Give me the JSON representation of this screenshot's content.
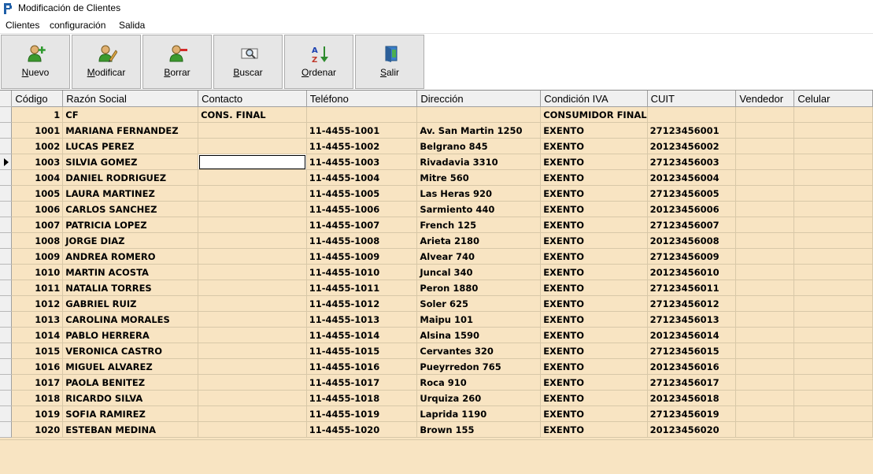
{
  "window": {
    "title": "Modificación de Clientes"
  },
  "menu": [
    "Clientes",
    "configuración",
    "Salida"
  ],
  "toolbar": {
    "nuevo": "Nuevo",
    "modificar": "Modificar",
    "borrar": "Borrar",
    "buscar": "Buscar",
    "ordenar": "Ordenar",
    "salir": "Salir"
  },
  "grid": {
    "columns": [
      "Código",
      "Razón Social",
      "Contacto",
      "Teléfono",
      "Dirección",
      "Condición IVA",
      "CUIT",
      "Vendedor",
      "Celular"
    ],
    "rows": [
      [
        "1",
        "CF",
        "CONS. FINAL",
        "",
        "",
        "CONSUMIDOR FINAL",
        "",
        "",
        ""
      ],
      [
        "1001",
        "MARIANA FERNANDEZ",
        "",
        "11-4455-1001",
        "Av. San Martin 1250",
        "EXENTO",
        "27123456001",
        "",
        ""
      ],
      [
        "1002",
        "LUCAS PEREZ",
        "",
        "11-4455-1002",
        "Belgrano 845",
        "EXENTO",
        "20123456002",
        "",
        ""
      ],
      [
        "1003",
        "SILVIA GOMEZ",
        "",
        "11-4455-1003",
        "Rivadavia 3310",
        "EXENTO",
        "27123456003",
        "",
        ""
      ],
      [
        "1004",
        "DANIEL RODRIGUEZ",
        "",
        "11-4455-1004",
        "Mitre 560",
        "EXENTO",
        "20123456004",
        "",
        ""
      ],
      [
        "1005",
        "LAURA MARTINEZ",
        "",
        "11-4455-1005",
        "Las Heras 920",
        "EXENTO",
        "27123456005",
        "",
        ""
      ],
      [
        "1006",
        "CARLOS SANCHEZ",
        "",
        "11-4455-1006",
        "Sarmiento 440",
        "EXENTO",
        "20123456006",
        "",
        ""
      ],
      [
        "1007",
        "PATRICIA LOPEZ",
        "",
        "11-4455-1007",
        "French 125",
        "EXENTO",
        "27123456007",
        "",
        ""
      ],
      [
        "1008",
        "JORGE DIAZ",
        "",
        "11-4455-1008",
        "Arieta 2180",
        "EXENTO",
        "20123456008",
        "",
        ""
      ],
      [
        "1009",
        "ANDREA ROMERO",
        "",
        "11-4455-1009",
        "Alvear 740",
        "EXENTO",
        "27123456009",
        "",
        ""
      ],
      [
        "1010",
        "MARTIN ACOSTA",
        "",
        "11-4455-1010",
        "Juncal 340",
        "EXENTO",
        "20123456010",
        "",
        ""
      ],
      [
        "1011",
        "NATALIA TORRES",
        "",
        "11-4455-1011",
        "Peron 1880",
        "EXENTO",
        "27123456011",
        "",
        ""
      ],
      [
        "1012",
        "GABRIEL RUIZ",
        "",
        "11-4455-1012",
        "Soler 625",
        "EXENTO",
        "27123456012",
        "",
        ""
      ],
      [
        "1013",
        "CAROLINA MORALES",
        "",
        "11-4455-1013",
        "Maipu 101",
        "EXENTO",
        "27123456013",
        "",
        ""
      ],
      [
        "1014",
        "PABLO HERRERA",
        "",
        "11-4455-1014",
        "Alsina 1590",
        "EXENTO",
        "20123456014",
        "",
        ""
      ],
      [
        "1015",
        "VERONICA CASTRO",
        "",
        "11-4455-1015",
        "Cervantes 320",
        "EXENTO",
        "27123456015",
        "",
        ""
      ],
      [
        "1016",
        "MIGUEL ALVAREZ",
        "",
        "11-4455-1016",
        "Pueyrredon 765",
        "EXENTO",
        "20123456016",
        "",
        ""
      ],
      [
        "1017",
        "PAOLA BENITEZ",
        "",
        "11-4455-1017",
        "Roca 910",
        "EXENTO",
        "27123456017",
        "",
        ""
      ],
      [
        "1018",
        "RICARDO SILVA",
        "",
        "11-4455-1018",
        "Urquiza 260",
        "EXENTO",
        "20123456018",
        "",
        ""
      ],
      [
        "1019",
        "SOFIA RAMIREZ",
        "",
        "11-4455-1019",
        "Laprida 1190",
        "EXENTO",
        "27123456019",
        "",
        ""
      ],
      [
        "1020",
        "ESTEBAN MEDINA",
        "",
        "11-4455-1020",
        "Brown 155",
        "EXENTO",
        "20123456020",
        "",
        ""
      ]
    ]
  }
}
